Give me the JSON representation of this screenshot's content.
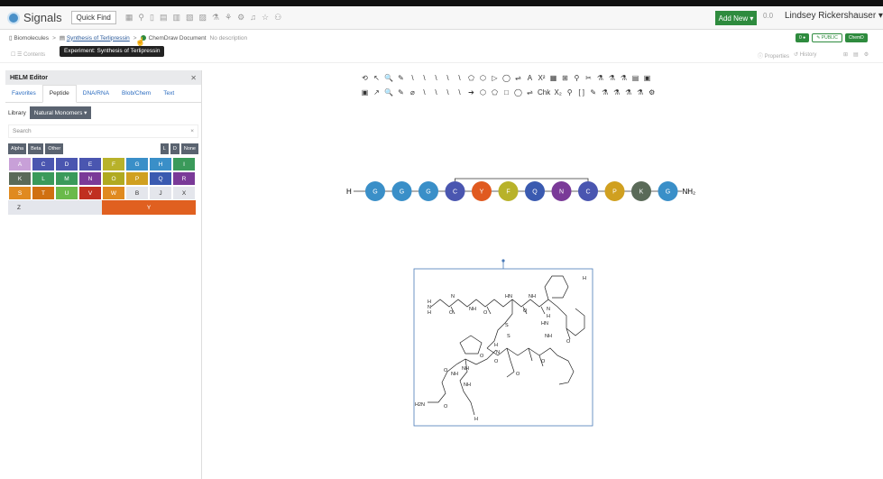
{
  "app": {
    "name": "Signals",
    "quick_find": "Quick Find",
    "add_new": "Add New ▾",
    "user_initials": "0.0",
    "user_name": "Lindsey Rickershauser ▾"
  },
  "breadcrumb": {
    "root": "Biomolecules",
    "experiment": "Synthesis of Terlipressin",
    "document": "ChemDraw Document",
    "description": "No description"
  },
  "tooltip": "Experiment: Synthesis of Terlipressin",
  "status_pills": [
    "0 ●",
    "✎ PUBLIC",
    "ChemD"
  ],
  "subbar": {
    "contents": "Contents",
    "properties": "Properties",
    "history": "History"
  },
  "helm": {
    "title": "HELM Editor",
    "tabs": [
      "Favorites",
      "Peptide",
      "DNA/RNA",
      "Blob/Chem",
      "Text"
    ],
    "library_label": "Library",
    "library_value": "Natural Monomers ▾",
    "search_placeholder": "Search",
    "filters_left": [
      "Alpha",
      "Beta",
      "Other"
    ],
    "filters_right": [
      "L",
      "D",
      "None"
    ],
    "monomers": [
      {
        "label": "A",
        "color": "#c8a0d8"
      },
      {
        "label": "C",
        "color": "#4a56b0"
      },
      {
        "label": "D",
        "color": "#4a56b0"
      },
      {
        "label": "E",
        "color": "#4a56b0"
      },
      {
        "label": "F",
        "color": "#b8b22a"
      },
      {
        "label": "G",
        "color": "#3a8fc8"
      },
      {
        "label": "H",
        "color": "#3a8fc8"
      },
      {
        "label": "I",
        "color": "#3a9a5a"
      },
      {
        "label": "K",
        "color": "#5a6a58"
      },
      {
        "label": "L",
        "color": "#3a9a5a"
      },
      {
        "label": "M",
        "color": "#3a9a5a"
      },
      {
        "label": "N",
        "color": "#7a3a98"
      },
      {
        "label": "O",
        "color": "#b0aa20"
      },
      {
        "label": "P",
        "color": "#d0a020"
      },
      {
        "label": "Q",
        "color": "#3a5ab0"
      },
      {
        "label": "R",
        "color": "#7a3a98"
      },
      {
        "label": "S",
        "color": "#e08a20"
      },
      {
        "label": "T",
        "color": "#d07010"
      },
      {
        "label": "U",
        "color": "#6aba4a"
      },
      {
        "label": "V",
        "color": "#c03020"
      },
      {
        "label": "W",
        "color": "#e08a20"
      },
      {
        "label": "B",
        "color": "#e4e6ec"
      },
      {
        "label": "J",
        "color": "#e4e6ec"
      },
      {
        "label": "X",
        "color": "#e4e6ec"
      }
    ],
    "z_label": "Z",
    "y_label": "Y"
  },
  "chemdraw_toolbar": {
    "row1": [
      "⟲",
      "↖",
      "🔍",
      "✎",
      "\\",
      "\\",
      "\\",
      "\\",
      "\\",
      "⬠",
      "⬡",
      "▷",
      "◯",
      "⇌",
      "A",
      "X²",
      "▦",
      "⊞",
      "⚲",
      "✂",
      "⚗",
      "⚗",
      "⚗",
      "▤",
      "▣"
    ],
    "row2": [
      "▣",
      "↗",
      "🔍",
      "✎",
      "⌀",
      "\\",
      "\\",
      "\\",
      "\\",
      "➔",
      "⬡",
      "⬠",
      "□",
      "◯",
      "⇌",
      "Chk",
      "X₂",
      "⚲",
      "[ ]",
      "✎",
      "⚗",
      "⚗",
      "⚗",
      "⚗",
      "⚙"
    ]
  },
  "peptide": {
    "n_term": "H",
    "c_term": "NH₂",
    "residues": [
      {
        "label": "G",
        "color": "#3a8fc8"
      },
      {
        "label": "G",
        "color": "#3a8fc8"
      },
      {
        "label": "G",
        "color": "#3a8fc8"
      },
      {
        "label": "C",
        "color": "#4a56b0"
      },
      {
        "label": "Y",
        "color": "#e05a20"
      },
      {
        "label": "F",
        "color": "#b8b22a"
      },
      {
        "label": "Q",
        "color": "#3a5ab0"
      },
      {
        "label": "N",
        "color": "#7a3a98"
      },
      {
        "label": "C",
        "color": "#4a56b0"
      },
      {
        "label": "P",
        "color": "#d0a020"
      },
      {
        "label": "K",
        "color": "#5a6a58"
      },
      {
        "label": "G",
        "color": "#3a8fc8"
      }
    ]
  },
  "structure_labels": [
    "H",
    "N",
    "H",
    "H",
    "N",
    "O",
    "NH",
    "O",
    "HN",
    "O",
    "NH",
    "N",
    "H",
    "S",
    "S",
    "HN",
    "NH",
    "O",
    "O",
    "O",
    "O",
    "NH",
    "O",
    "N",
    "H",
    "NH",
    "O",
    "H2N",
    "O",
    "NH",
    "H"
  ]
}
